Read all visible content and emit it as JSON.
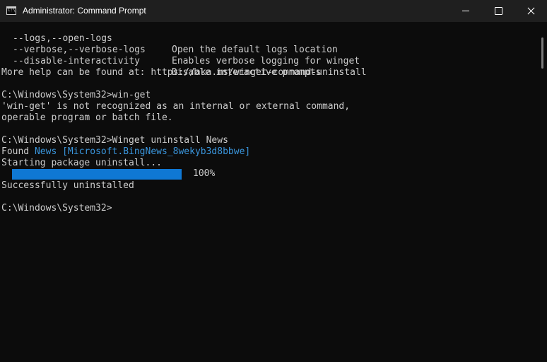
{
  "window": {
    "title": "Administrator: Command Prompt",
    "icon": "cmd-icon",
    "icon_text": "C:\\",
    "controls": [
      "minimize-icon",
      "maximize-icon",
      "close-icon"
    ]
  },
  "console": {
    "options": [
      {
        "flag": "--logs,--open-logs",
        "desc": "Open the default logs location"
      },
      {
        "flag": "--verbose,--verbose-logs",
        "desc": "Enables verbose logging for winget"
      },
      {
        "flag": "--disable-interactivity",
        "desc": "Disable interactive prompts"
      }
    ],
    "help_line": "More help can be found at: https://aka.ms/winget-command-uninstall",
    "cmd1": "C:\\Windows\\System32>win-get",
    "error_line1": "'win-get' is not recognized as an internal or external command,",
    "error_line2": "operable program or batch file.",
    "cmd2": "C:\\Windows\\System32>Winget uninstall News",
    "found_prefix": "Found ",
    "found_name": "News",
    "found_space": " ",
    "found_id": "[Microsoft.BingNews_8wekyb3d8bbwe]",
    "starting": "Starting package uninstall...",
    "progress_value": 100,
    "progress_label": "100%",
    "success": "Successfully uninstalled",
    "prompt": "C:\\Windows\\System32>"
  },
  "colors": {
    "background": "#0c0c0c",
    "text": "#cccccc",
    "highlight": "#3a96dd",
    "progress": "#0f78d4",
    "titlebar": "#1f1f1f"
  }
}
